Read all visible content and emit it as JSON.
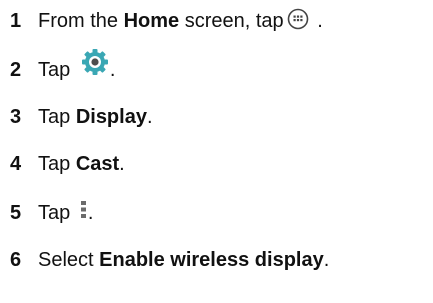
{
  "steps": [
    {
      "num": "1",
      "pre": "From the ",
      "bold": "Home",
      "post": " screen, tap",
      "icon": "apps-grid-icon",
      "end": " ."
    },
    {
      "num": "2",
      "pre": "Tap ",
      "icon": "settings-gear-icon",
      "end": "."
    },
    {
      "num": "3",
      "pre": "Tap ",
      "bold": "Display",
      "end": "."
    },
    {
      "num": "4",
      "pre": "Tap ",
      "bold": "Cast",
      "end": "."
    },
    {
      "num": "5",
      "pre": "Tap ",
      "icon": "overflow-menu-icon",
      "end": "."
    },
    {
      "num": "6",
      "pre": "Select ",
      "bold": "Enable wireless display",
      "end": "."
    }
  ],
  "colors": {
    "text": "#111111",
    "settings_icon": "#3aa7b4",
    "icon_dark": "#444444"
  }
}
